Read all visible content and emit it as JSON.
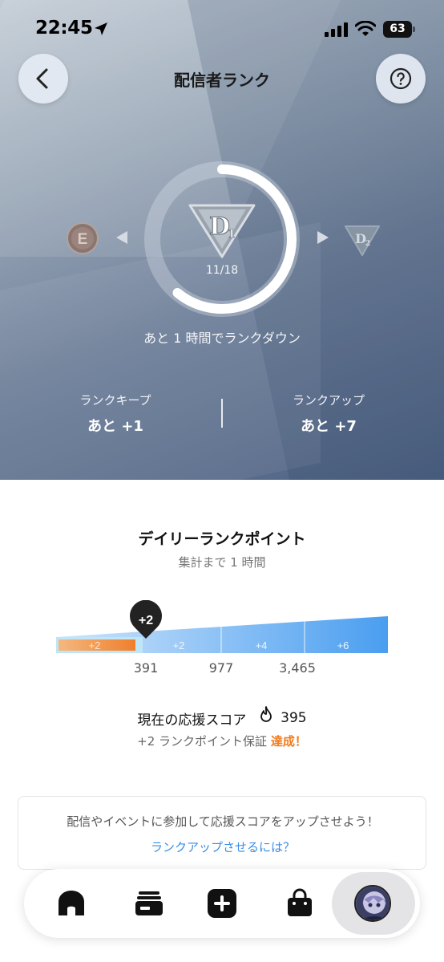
{
  "status_bar": {
    "time": "22:45",
    "battery": "63"
  },
  "header": {
    "title": "配信者ランク"
  },
  "rank": {
    "current_label": "D",
    "current_sub": "1",
    "next_label": "D",
    "next_sub": "2",
    "prev_label": "E",
    "progress_text": "11/18",
    "progress_fraction": 0.61,
    "down_note": "あと 1 時間でランクダウン"
  },
  "stats": {
    "keep_label": "ランクキープ",
    "keep_value": "あと +1",
    "up_label": "ランクアップ",
    "up_value": "あと +7"
  },
  "daily": {
    "title": "デイリーランクポイント",
    "subtitle": "集計まで 1 時間",
    "marker": "+2",
    "segments": [
      "+2",
      "+2",
      "+4",
      "+6"
    ],
    "thresholds": [
      "391",
      "977",
      "3,465"
    ],
    "score_label": "現在の応援スコア",
    "score_value": "395",
    "guarantee_text": "+2 ランクポイント保証",
    "guarantee_status": "達成！",
    "colors": {
      "achieved": "#f0893a",
      "bar": "#5aa6f0",
      "marker": "#222222"
    }
  },
  "tip": {
    "text": "配信やイベントに参加して応援スコアをアップさせよう！",
    "link": "ランクアップさせるには？"
  },
  "tabbar": {
    "items": [
      "home-icon",
      "list-icon",
      "plus-icon",
      "bag-icon",
      "avatar"
    ],
    "active": "avatar"
  }
}
